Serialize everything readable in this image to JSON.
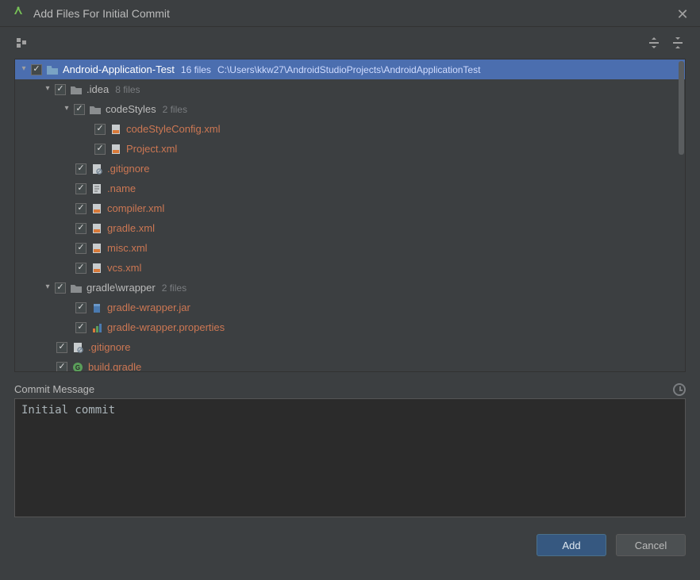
{
  "window": {
    "title": "Add Files For Initial Commit"
  },
  "tree": {
    "root": {
      "name": "Android-Application-Test",
      "count": "16 files",
      "path": "C:\\Users\\kkw27\\AndroidStudioProjects\\AndroidApplicationTest"
    },
    "idea": {
      "name": ".idea",
      "count": "8 files"
    },
    "codeStyles": {
      "name": "codeStyles",
      "count": "2 files"
    },
    "csc": "codeStyleConfig.xml",
    "proj": "Project.xml",
    "gitignore1": ".gitignore",
    "nm": ".name",
    "compiler": "compiler.xml",
    "gradlexml": "gradle.xml",
    "misc": "misc.xml",
    "vcs": "vcs.xml",
    "gradlewrap": {
      "name": "gradle\\wrapper",
      "count": "2 files"
    },
    "gwjar": "gradle-wrapper.jar",
    "gwprop": "gradle-wrapper.properties",
    "gitignore2": ".gitignore",
    "buildgradle": "build.gradle"
  },
  "commit": {
    "label": "Commit Message",
    "text": "Initial commit"
  },
  "buttons": {
    "add": "Add",
    "cancel": "Cancel"
  }
}
